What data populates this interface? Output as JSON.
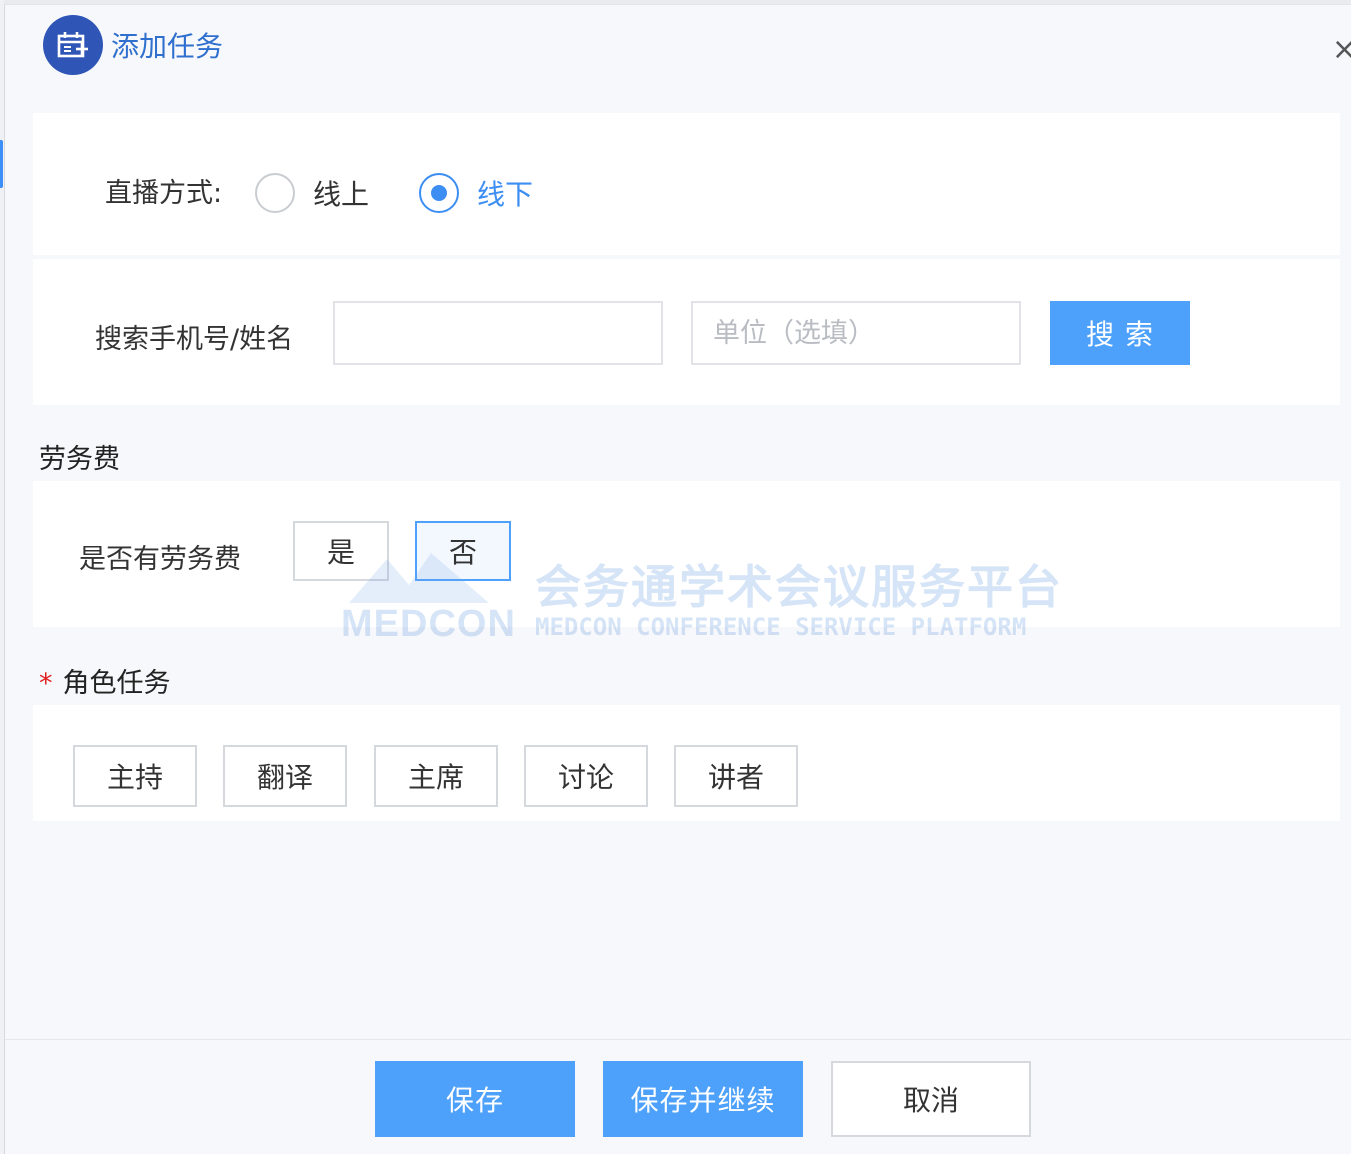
{
  "dialog": {
    "title": "添加任务",
    "close_symbol": "×"
  },
  "live_mode": {
    "label": "直播方式:",
    "options": [
      {
        "label": "线上",
        "checked": false
      },
      {
        "label": "线下",
        "checked": true
      }
    ]
  },
  "search": {
    "label": "搜索手机号/姓名",
    "phone_value": "",
    "unit_placeholder": "单位（选填）",
    "button_label": "搜 索"
  },
  "fee": {
    "section_title": "劳务费",
    "question": "是否有劳务费",
    "options": [
      {
        "label": "是",
        "selected": false
      },
      {
        "label": "否",
        "selected": true
      }
    ]
  },
  "roles": {
    "required_mark": "*",
    "section_title": "角色任务",
    "items": [
      "主持",
      "翻译",
      "主席",
      "讨论",
      "讲者"
    ]
  },
  "watermark": {
    "brand": "MEDCON",
    "title_cn": "会务通学术会议服务平台",
    "title_en": "MEDCON CONFERENCE SERVICE PLATFORM"
  },
  "footer": {
    "save": "保存",
    "save_continue": "保存并继续",
    "cancel": "取消"
  },
  "colors": {
    "primary": "#4ea1fb",
    "header_icon_bg": "#2f56b6",
    "title": "#2f6fce",
    "required": "#e02020"
  }
}
